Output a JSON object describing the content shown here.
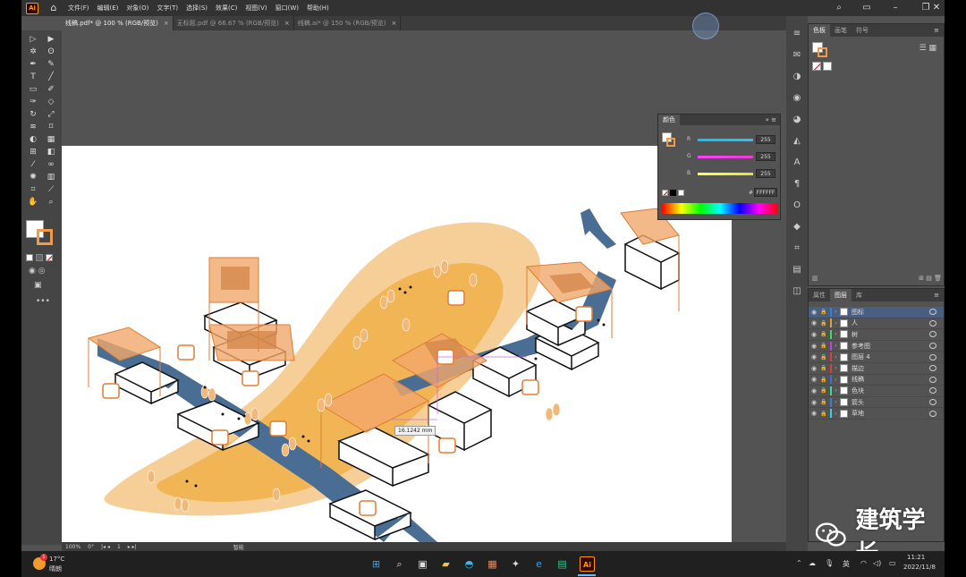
{
  "app": {
    "logo": "Ai"
  },
  "menu": [
    "文件(F)",
    "编辑(E)",
    "对象(O)",
    "文字(T)",
    "选择(S)",
    "效果(C)",
    "视图(V)",
    "窗口(W)",
    "帮助(H)"
  ],
  "tabs": [
    {
      "label": "线稿.pdf* @ 100 % (RGB/预览)",
      "active": true
    },
    {
      "label": "无标题.pdf @ 66.67 % (RGB/预览)",
      "active": false
    },
    {
      "label": "线稿.ai* @ 150 % (RGB/预览)",
      "active": false
    }
  ],
  "swatch_panel": {
    "tabs": [
      "色板",
      "画笔",
      "符号"
    ]
  },
  "color_panel": {
    "title": "颜色",
    "sliders": [
      {
        "label": "R",
        "value": "255",
        "track_color": "#2ec4e8"
      },
      {
        "label": "G",
        "value": "255",
        "track_color": "#e83ad8"
      },
      {
        "label": "B",
        "value": "255",
        "track_color": "#e8e03a"
      }
    ],
    "hex_label": "#",
    "hex_value": "FFFFFF"
  },
  "layers_panel": {
    "tabs": [
      "属性",
      "图层",
      "库"
    ],
    "layers": [
      {
        "name": "图标",
        "color": "#3b7be0",
        "selected": true
      },
      {
        "name": "人",
        "color": "#e0a03b",
        "selected": false
      },
      {
        "name": "树",
        "color": "#3be05a",
        "selected": false
      },
      {
        "name": "参考图",
        "color": "#d03be0",
        "selected": false
      },
      {
        "name": "图层 4",
        "color": "#e03b3b",
        "selected": false
      },
      {
        "name": "描边",
        "color": "#e03b3b",
        "selected": false
      },
      {
        "name": "线稿",
        "color": "#3b6fe0",
        "selected": false
      },
      {
        "name": "色块",
        "color": "#3be08a",
        "selected": false
      },
      {
        "name": "箭头",
        "color": "#3b7be0",
        "selected": false
      },
      {
        "name": "草地",
        "color": "#3bd0e0",
        "selected": false
      }
    ]
  },
  "canvas": {
    "measure_label": "16.1242 mm"
  },
  "status": {
    "zoom": "100%",
    "rotation": "0°",
    "artboard": "1",
    "tool": "智能"
  },
  "taskbar": {
    "weather_temp": "17°C",
    "weather_desc": "晴朗",
    "weather_badge": "1",
    "ime": "英",
    "time": "11:21",
    "date": "2022/11/8"
  },
  "watermark": "建筑学长"
}
